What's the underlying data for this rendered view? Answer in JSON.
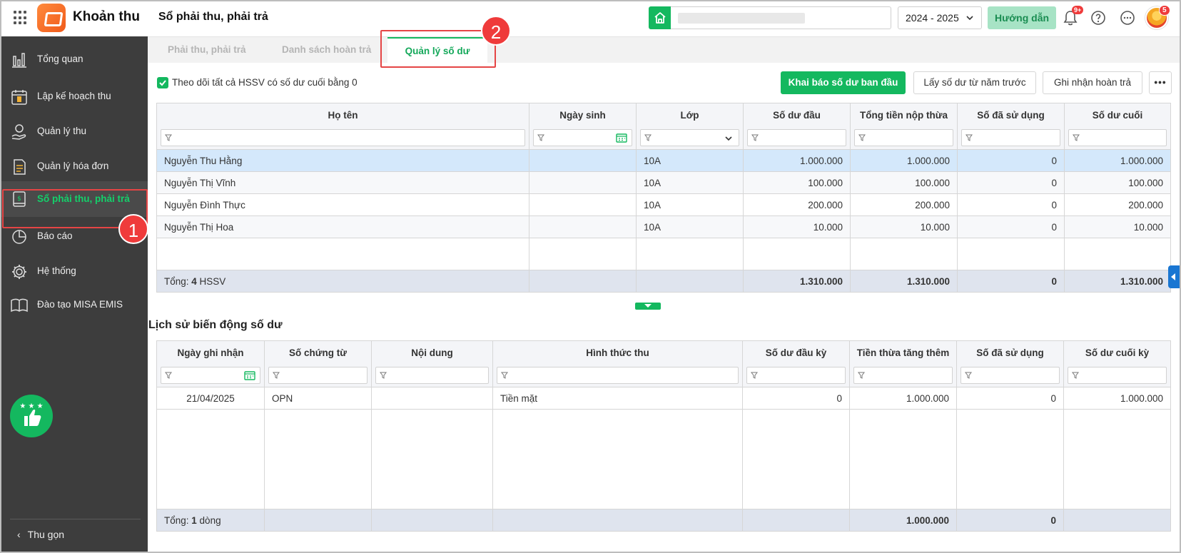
{
  "app": {
    "name": "Khoản thu",
    "page_title": "Sổ phải thu, phải trả"
  },
  "topbar": {
    "search_value": "",
    "year": "2024 - 2025",
    "guide_label": "Hướng dẫn",
    "notification_count": "9+",
    "avatar_badge": "5"
  },
  "sidebar": {
    "items": [
      {
        "label": "Tổng quan",
        "icon": "chart-bar-icon"
      },
      {
        "label": "Lập kế hoạch thu",
        "icon": "calendar-money-icon"
      },
      {
        "label": "Quản lý thu",
        "icon": "hand-money-icon"
      },
      {
        "label": "Quản lý hóa đơn",
        "icon": "invoice-icon"
      },
      {
        "label": "Sổ phải thu, phải trả",
        "icon": "ledger-icon"
      },
      {
        "label": "Báo cáo",
        "icon": "pie-chart-icon"
      },
      {
        "label": "Hệ thống",
        "icon": "gear-icon"
      },
      {
        "label": "Đào tạo MISA EMIS",
        "icon": "book-icon"
      }
    ],
    "collapse_label": "Thu gọn"
  },
  "annotations": {
    "step1": "1",
    "step2": "2"
  },
  "tabs": [
    {
      "label": "Phải thu, phải trả"
    },
    {
      "label": "Danh sách hoàn trả"
    },
    {
      "label": "Quản lý số dư"
    }
  ],
  "toolbar": {
    "checkbox_label": "Theo dõi tất cả HSSV có số dư cuối bằng 0",
    "declare_label": "Khai báo số dư ban đầu",
    "fetch_label": "Lấy số dư từ năm trước",
    "refund_label": "Ghi nhận hoàn trả",
    "more_label": "•••"
  },
  "balance_table": {
    "headers": [
      "Họ tên",
      "Ngày sinh",
      "Lớp",
      "Số dư đầu",
      "Tổng tiền nộp thừa",
      "Số đã sử dụng",
      "Số dư cuối"
    ],
    "rows": [
      [
        "Nguyễn Thu Hằng",
        "",
        "10A",
        "1.000.000",
        "1.000.000",
        "0",
        "1.000.000"
      ],
      [
        "Nguyễn Thị Vĩnh",
        "",
        "10A",
        "100.000",
        "100.000",
        "0",
        "100.000"
      ],
      [
        "Nguyễn Đình Thực",
        "",
        "10A",
        "200.000",
        "200.000",
        "0",
        "200.000"
      ],
      [
        "Nguyễn Thị Hoa",
        "",
        "10A",
        "10.000",
        "10.000",
        "0",
        "10.000"
      ]
    ],
    "total_prefix": "Tổng: ",
    "total_count": "4",
    "total_suffix": " HSSV",
    "totals": [
      "1.310.000",
      "1.310.000",
      "0",
      "1.310.000"
    ]
  },
  "history": {
    "title": "Lịch sử biến động số dư",
    "headers": [
      "Ngày ghi nhận",
      "Số chứng từ",
      "Nội dung",
      "Hình thức thu",
      "Số dư đầu kỳ",
      "Tiền thừa tăng thêm",
      "Số đã sử dụng",
      "Số dư cuối kỳ"
    ],
    "rows": [
      [
        "21/04/2025",
        "OPN",
        "",
        "Tiền mặt",
        "0",
        "1.000.000",
        "0",
        "1.000.000"
      ]
    ],
    "total_prefix": "Tổng: ",
    "total_count": "1",
    "total_suffix": " dòng",
    "totals": [
      "1.000.000",
      "0",
      ""
    ]
  }
}
